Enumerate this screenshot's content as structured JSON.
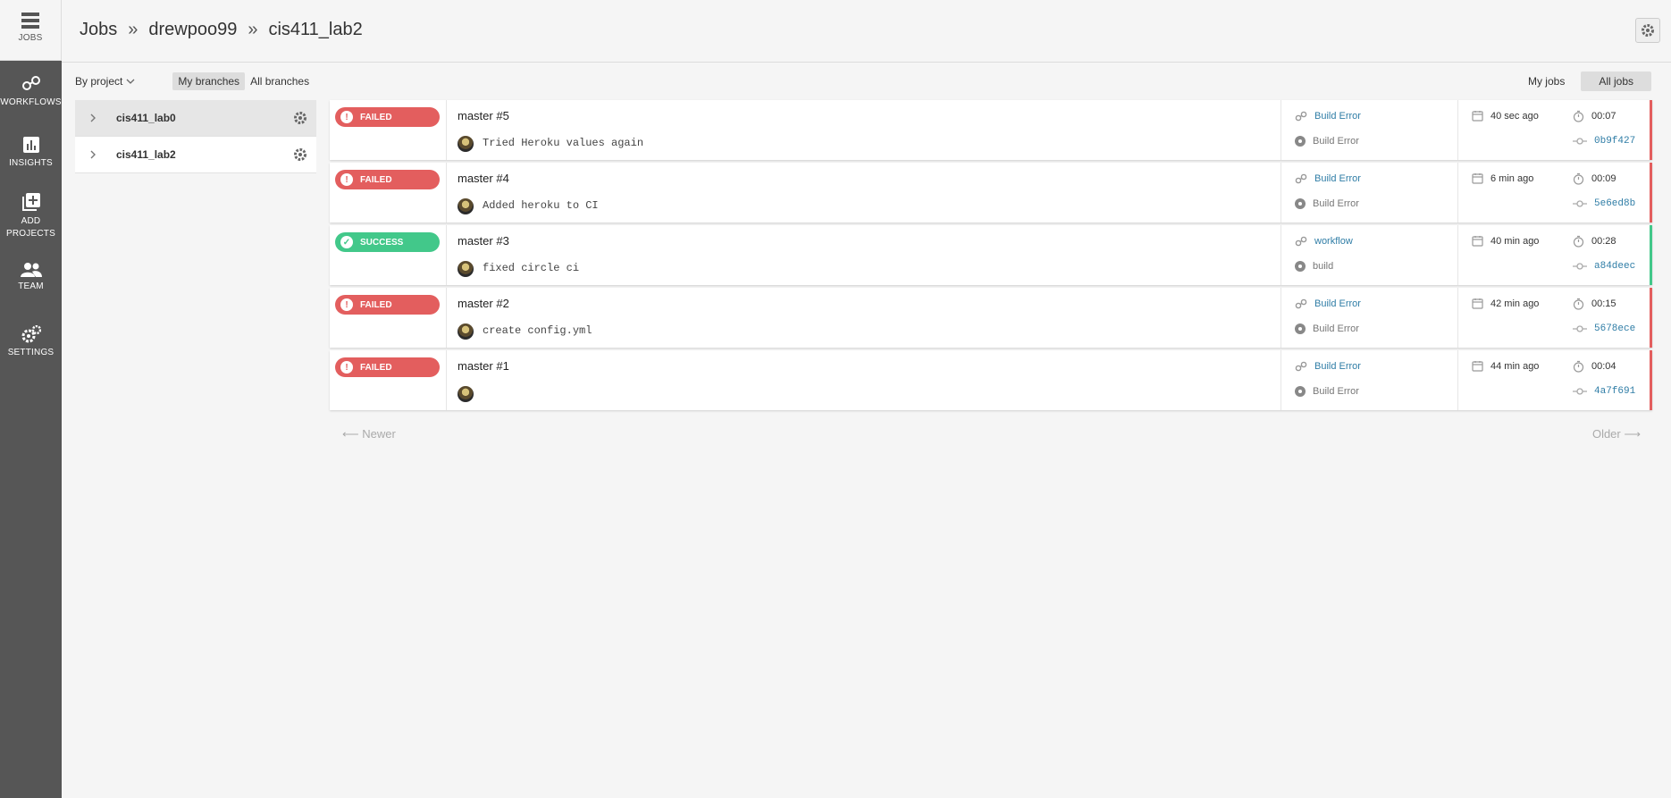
{
  "nav": {
    "jobs": "JOBS",
    "workflows": "WORKFLOWS",
    "insights": "INSIGHTS",
    "add_projects_1": "ADD",
    "add_projects_2": "PROJECTS",
    "team": "TEAM",
    "settings": "SETTINGS"
  },
  "breadcrumb": [
    "Jobs",
    "drewpoo99",
    "cis411_lab2"
  ],
  "breadcrumb_sep": "»",
  "filters": {
    "by_project": "By project",
    "my_branches": "My branches",
    "all_branches": "All branches",
    "my_jobs": "My jobs",
    "all_jobs": "All jobs"
  },
  "projects": [
    {
      "name": "cis411_lab0"
    },
    {
      "name": "cis411_lab2"
    }
  ],
  "builds": [
    {
      "status": "FAILED",
      "title": "master #5",
      "commit": "Tried Heroku values again",
      "workflow": "Build Error",
      "job": "Build Error",
      "when": "40 sec ago",
      "duration": "00:07",
      "sha": "0b9f427"
    },
    {
      "status": "FAILED",
      "title": "master #4",
      "commit": "Added heroku to CI",
      "workflow": "Build Error",
      "job": "Build Error",
      "when": "6 min ago",
      "duration": "00:09",
      "sha": "5e6ed8b"
    },
    {
      "status": "SUCCESS",
      "title": "master #3",
      "commit": "fixed circle ci",
      "workflow": "workflow",
      "job": "build",
      "when": "40 min ago",
      "duration": "00:28",
      "sha": "a84deec"
    },
    {
      "status": "FAILED",
      "title": "master #2",
      "commit": "create config.yml",
      "workflow": "Build Error",
      "job": "Build Error",
      "when": "42 min ago",
      "duration": "00:15",
      "sha": "5678ece"
    },
    {
      "status": "FAILED",
      "title": "master #1",
      "commit": "",
      "workflow": "Build Error",
      "job": "Build Error",
      "when": "44 min ago",
      "duration": "00:04",
      "sha": "4a7f691"
    }
  ],
  "pager": {
    "newer": "⟵ Newer",
    "older": "Older ⟶"
  },
  "colors": {
    "failed": "#e35e5e",
    "success": "#42c88a",
    "link": "#2f7da6"
  }
}
